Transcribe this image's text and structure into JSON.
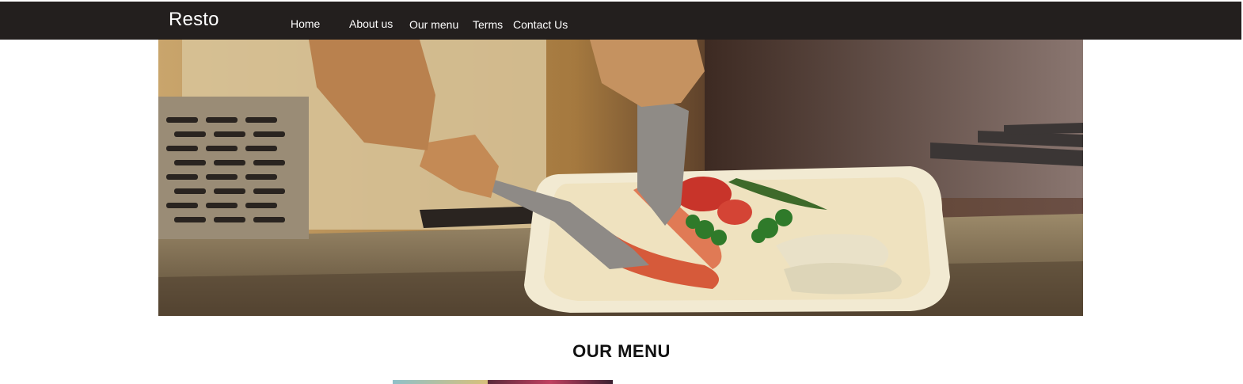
{
  "navbar": {
    "brand": "Resto",
    "links": [
      {
        "label": "Home"
      },
      {
        "label": "About us"
      },
      {
        "label": "Our menu"
      },
      {
        "label": "Terms"
      },
      {
        "label": "Contact Us"
      }
    ],
    "background_color": "#231f1e"
  },
  "hero": {
    "image": "chef-plating-shrimp-photo"
  },
  "menu_section": {
    "title": "OUR MENU"
  }
}
